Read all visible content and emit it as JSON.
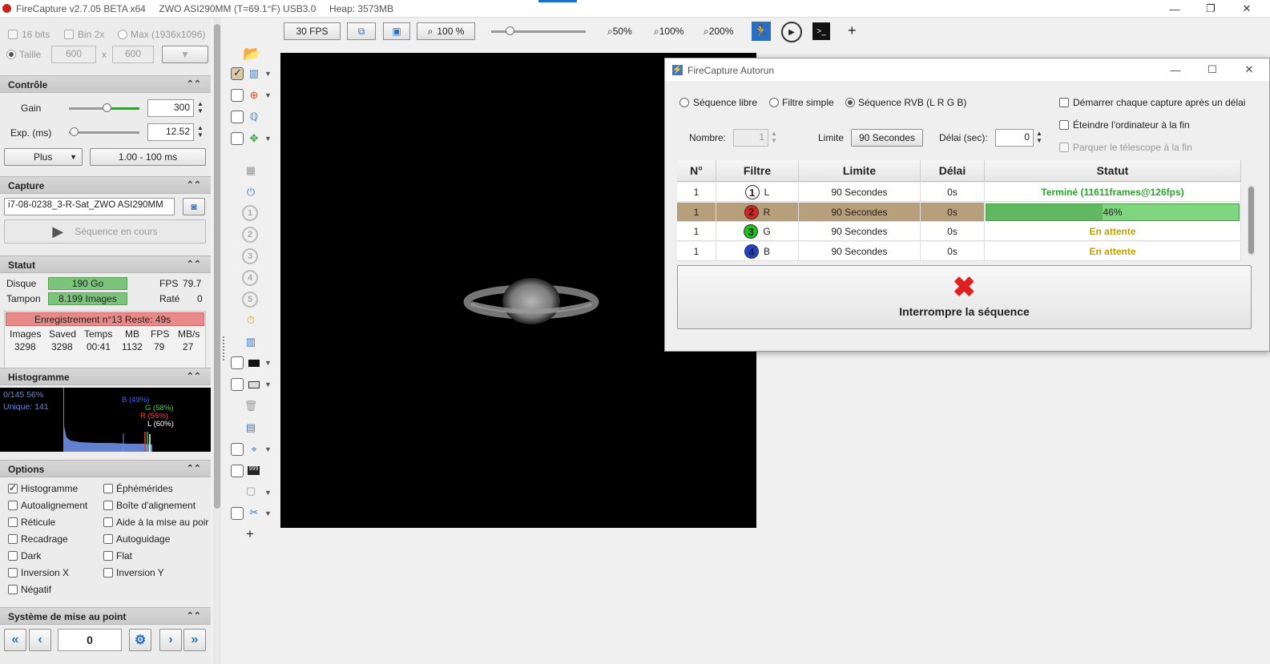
{
  "titlebar": {
    "text": "FireCapture v2.7.05 BETA x64     ZWO ASI290MM (T=69.1°F) USB3.0     Heap: 3573MB",
    "min": "—",
    "max": "❐",
    "close": "✕"
  },
  "resolution": {
    "bits16": "16 bits",
    "bin2x": "Bin 2x",
    "max": "Max (1936x1096)",
    "taille": "Taille",
    "width": "600",
    "x": "x",
    "height": "600"
  },
  "controle": {
    "header": "Contrôle",
    "gain_label": "Gain",
    "gain_value": "300",
    "gain_level": 0.55,
    "exp_label": "Exp. (ms)",
    "exp_value": "12.52",
    "exp_level": 0.05,
    "plus": "Plus",
    "range": "1.00 - 100 ms"
  },
  "capture": {
    "header": "Capture",
    "filename": "i7-08-0238_3-R-Sat_ZWO ASI290MM",
    "seq_button": "Séquence en cours"
  },
  "statut": {
    "header": "Statut",
    "disque_label": "Disque",
    "disque_value": "190 Go",
    "fps_label": "FPS",
    "fps_value": "79.7",
    "tampon_label": "Tampon",
    "tampon_value": "8.199 Images",
    "rate_label": "Raté",
    "rate_value": "0",
    "recording": "Enregistrement n°13   Reste: 49s",
    "cols": [
      "Images",
      "Saved",
      "Temps",
      "MB",
      "FPS",
      "MB/s"
    ],
    "vals": [
      "3298",
      "3298",
      "00:41",
      "1132",
      "79",
      "27"
    ]
  },
  "histogramme": {
    "header": "Histogramme",
    "line1": "0/145 56%",
    "line2": "Unique: 141",
    "b": "B (49%)",
    "g": "G (58%)",
    "r": "R (55%)",
    "l": "L (60%)"
  },
  "options": {
    "header": "Options",
    "items": [
      {
        "label": "Histogramme",
        "checked": true
      },
      {
        "label": "Éphémérides",
        "checked": false
      },
      {
        "label": "Autoalignement",
        "checked": false
      },
      {
        "label": "Boîte d'alignement",
        "checked": false
      },
      {
        "label": "Réticule",
        "checked": false
      },
      {
        "label": "Aide à la mise au poir",
        "checked": false
      },
      {
        "label": "Recadrage",
        "checked": false
      },
      {
        "label": "Autoguidage",
        "checked": false
      },
      {
        "label": "Dark",
        "checked": false
      },
      {
        "label": "Flat",
        "checked": false
      },
      {
        "label": "Inversion X",
        "checked": false
      },
      {
        "label": "Inversion Y",
        "checked": false
      },
      {
        "label": "Négatif",
        "checked": false
      }
    ]
  },
  "focus": {
    "header": "Système de mise au point",
    "value": "0",
    "fast_back": "«",
    "back": "‹",
    "fwd": "›",
    "fast_fwd": "»"
  },
  "topbar": {
    "fps": "30 FPS",
    "zoom": "100 %",
    "z50": "50%",
    "z100": "100%",
    "z200": "200%",
    "plus": "+"
  },
  "toolcol": {
    "nums": [
      "1",
      "2",
      "3",
      "4",
      "5"
    ],
    "plus": "+"
  },
  "autorun": {
    "title": "FireCapture Autorun",
    "mode_libre": "Séquence libre",
    "mode_simple": "Filtre simple",
    "mode_rvb": "Séquence RVB (L R G B)",
    "opt_delay": "Démarrer chaque capture après un délai",
    "opt_shutdown": "Éteindre l'ordinateur à la fin",
    "opt_park": "Parquer le télescope à la fin",
    "nombre_label": "Nombre:",
    "nombre_value": "1",
    "limite_label": "Limite",
    "limite_value": "90 Secondes",
    "delai_label": "Délai (sec):",
    "delai_value": "0",
    "headers": [
      "N°",
      "Filtre",
      "Limite",
      "Délai",
      "Statut"
    ],
    "rows": [
      {
        "n": "1",
        "num": "1",
        "filter": "L",
        "limit": "90 Secondes",
        "delay": "0s",
        "status": "Terminé  (11611frames@126fps)",
        "color": "#ffffff",
        "text": "#000000"
      },
      {
        "n": "1",
        "num": "2",
        "filter": "R",
        "limit": "90 Secondes",
        "delay": "0s",
        "status": "46%",
        "progress": 0.46,
        "color": "#e02020",
        "text": "#000000"
      },
      {
        "n": "1",
        "num": "3",
        "filter": "G",
        "limit": "90 Secondes",
        "delay": "0s",
        "status": "En attente",
        "color": "#22c022",
        "text": "#000000"
      },
      {
        "n": "1",
        "num": "4",
        "filter": "B",
        "limit": "90 Secondes",
        "delay": "0s",
        "status": "En attente",
        "color": "#2040d0",
        "text": "#000000"
      }
    ],
    "stop": "Interrompre la séquence"
  },
  "colors": {
    "status_done": "#2aa52a",
    "status_wait": "#c0a000",
    "progress": "#7fd67f"
  }
}
